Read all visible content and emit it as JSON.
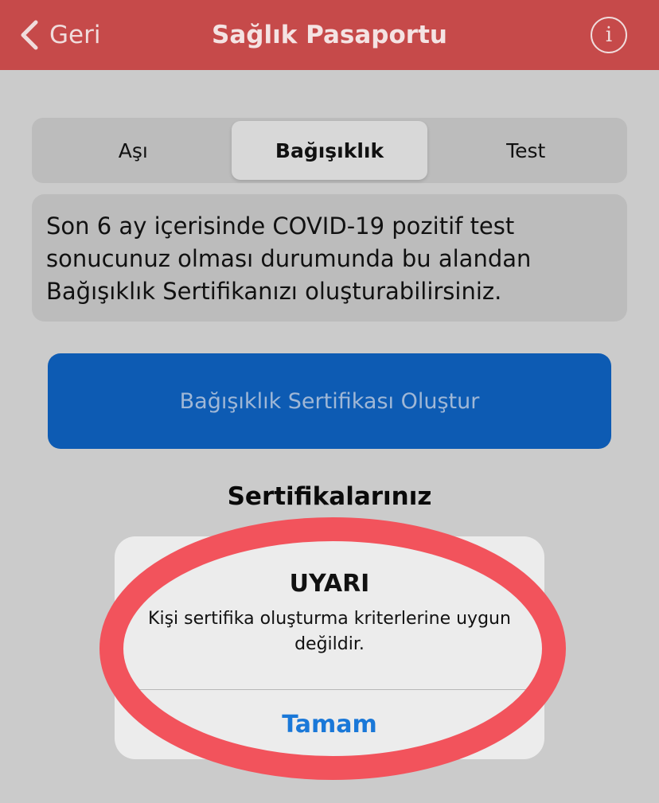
{
  "header": {
    "back_label": "Geri",
    "title": "Sağlık Pasaportu",
    "info_glyph": "i",
    "background_color": "#c64a4a"
  },
  "tabs": [
    {
      "label": "Aşı",
      "selected": false
    },
    {
      "label": "Bağışıklık",
      "selected": true
    },
    {
      "label": "Test",
      "selected": false
    }
  ],
  "info_text": "Son 6 ay içerisinde COVID-19 pozitif test sonucunuz olması durumunda bu alandan Bağışıklık Sertifikanızı oluşturabilirsiniz.",
  "create_button_label": "Bağışıklık Sertifikası Oluştur",
  "section_title": "Sertifikalarınız",
  "alert": {
    "title": "UYARI",
    "message": "Kişi sertifika oluşturma kriterlerine uygun değildir.",
    "ok_label": "Tamam"
  },
  "annotation": {
    "shape": "ellipse",
    "color": "#f2535c"
  },
  "icons": {
    "back": "chevron-left-icon",
    "info": "info-circle-icon"
  }
}
